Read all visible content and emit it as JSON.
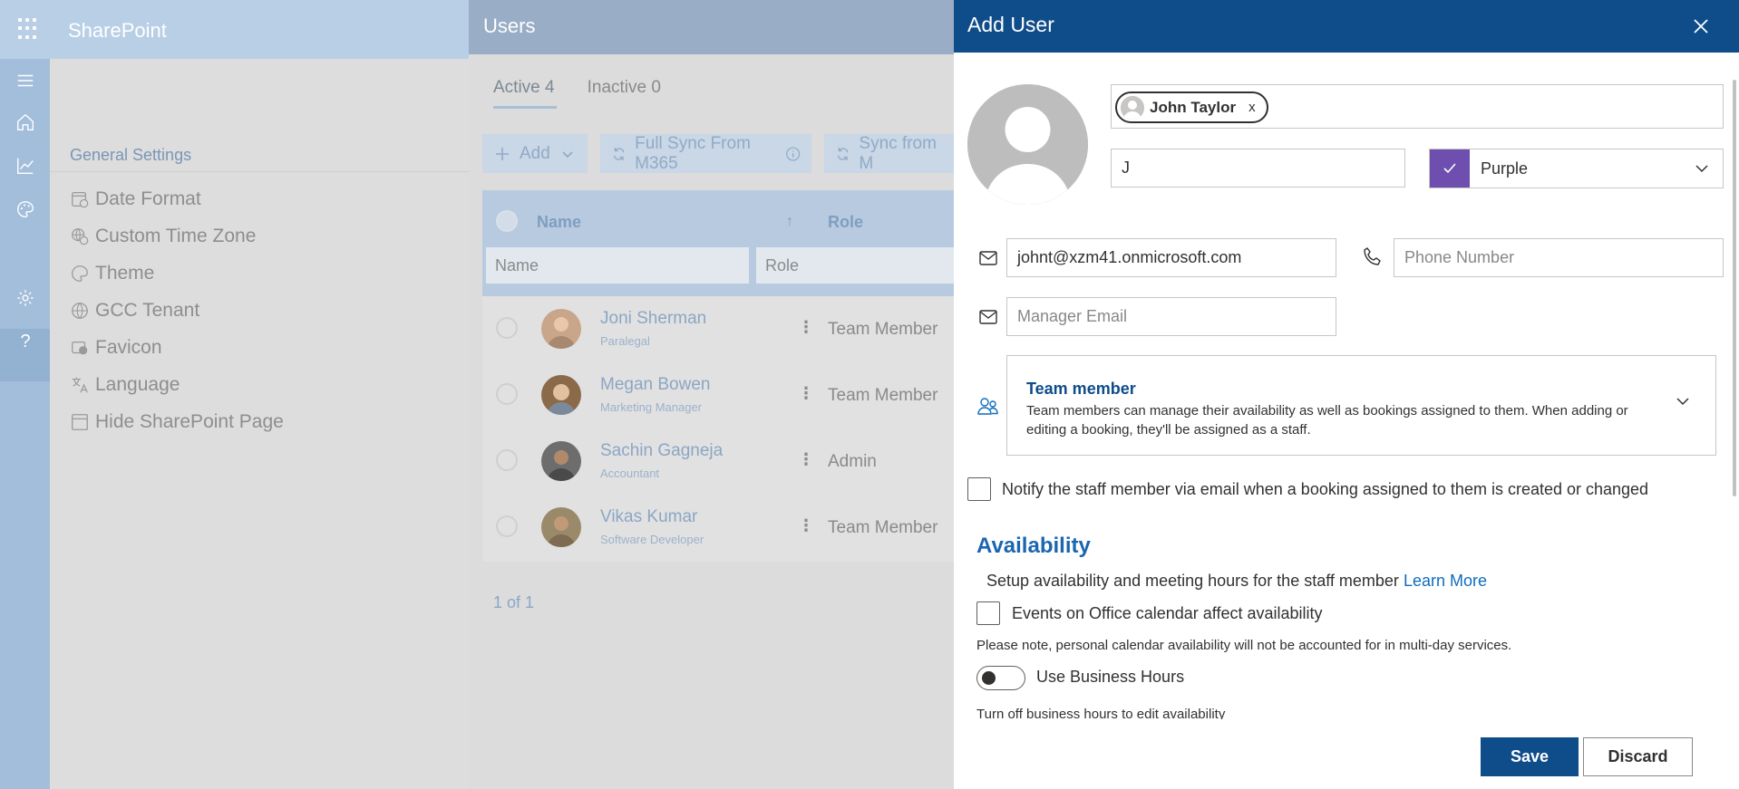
{
  "app": {
    "brand": "SharePoint"
  },
  "left_rail": {
    "icons": [
      "menu-icon",
      "home-icon",
      "chart-icon",
      "palette-icon",
      "gear-icon",
      "help-icon"
    ],
    "help_glyph": "?"
  },
  "settings": {
    "title": "General Settings",
    "items": [
      {
        "label": "Date Format",
        "icon": "calendar-clock-icon"
      },
      {
        "label": "Custom Time Zone",
        "icon": "globe-clock-icon"
      },
      {
        "label": "Theme",
        "icon": "palette-icon"
      },
      {
        "label": "GCC Tenant",
        "icon": "globe-icon"
      },
      {
        "label": "Favicon",
        "icon": "favicon-icon"
      },
      {
        "label": "Language",
        "icon": "language-icon"
      },
      {
        "label": "Hide SharePoint Page",
        "icon": "page-icon"
      }
    ]
  },
  "users": {
    "title": "Users",
    "tabs": [
      {
        "label": "Active 4"
      },
      {
        "label": "Inactive 0"
      }
    ],
    "toolbar": {
      "add_label": "Add",
      "full_sync_label": "Full Sync From M365",
      "sync_label": "Sync from M"
    },
    "columns": {
      "name": "Name",
      "role": "Role",
      "sort_glyph": "↑"
    },
    "filters": {
      "name_placeholder": "Name",
      "role_placeholder": "Role"
    },
    "rows": [
      {
        "name": "Joni Sherman",
        "title": "Paralegal",
        "role": "Team Member"
      },
      {
        "name": "Megan Bowen",
        "title": "Marketing Manager",
        "role": "Team Member"
      },
      {
        "name": "Sachin Gagneja",
        "title": "Accountant",
        "role": "Admin"
      },
      {
        "name": "Vikas Kumar",
        "title": "Software Developer",
        "role": "Team Member"
      }
    ],
    "row_menu_glyph": "⋮",
    "pager": "1 of 1"
  },
  "dialog": {
    "title": "Add User",
    "selected_person": "John Taylor",
    "remove_glyph": "x",
    "initials_value": "J",
    "color": {
      "label": "Purple",
      "value": "#6e4fb0"
    },
    "email_value": "johnt@xzm41.onmicrosoft.com",
    "phone_placeholder": "Phone Number",
    "manager_placeholder": "Manager Email",
    "role": {
      "title": "Team member",
      "description": "Team members can manage their availability as well as bookings assigned to them. When adding or editing a booking, they'll be assigned as a staff."
    },
    "notify_label": "Notify the staff member via email when a booking assigned to them is created or changed",
    "availability": {
      "title": "Availability",
      "description": "Setup availability and meeting hours for the staff member",
      "learn_more": "Learn More",
      "office_calendar_label": "Events on Office calendar affect availability",
      "note": "Please note, personal calendar availability will not be accounted for in multi-day services.",
      "business_hours_label": "Use Business Hours",
      "business_hours_hint": "Turn off business hours to edit availability"
    },
    "save_label": "Save",
    "discard_label": "Discard"
  }
}
